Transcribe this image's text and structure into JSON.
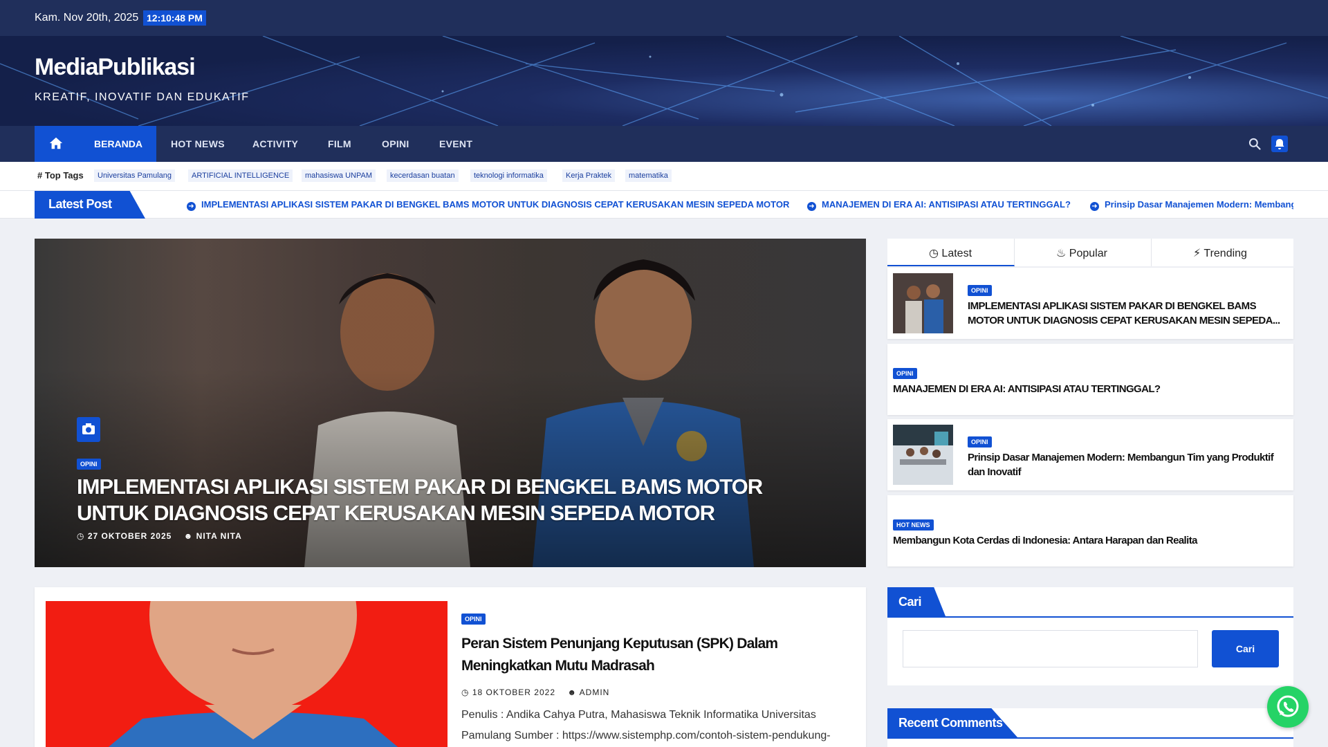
{
  "topbar": {
    "date": "Kam. Nov 20th, 2025",
    "time": "12:10:48 PM"
  },
  "site": {
    "title": "MediaPublikasi",
    "tagline": "KREATIF, INOVATIF DAN EDUKATIF"
  },
  "nav": {
    "home_label": "BERANDA",
    "items": [
      "HOT NEWS",
      "ACTIVITY",
      "FILM",
      "OPINI",
      "EVENT"
    ]
  },
  "top_tags": {
    "label": "Top Tags",
    "tags": [
      "Universitas Pamulang",
      "ARTIFICIAL INTELLIGENCE",
      "mahasiswa UNPAM",
      "kecerdasan buatan",
      "teknologi informatika",
      "Kerja Praktek",
      "matematika"
    ]
  },
  "ticker": {
    "label": "Latest Post",
    "items": [
      "IMPLEMENTASI APLIKASI SISTEM PAKAR DI BENGKEL BAMS MOTOR UNTUK DIAGNOSIS CEPAT KERUSAKAN MESIN SEPEDA MOTOR",
      "MANAJEMEN DI ERA AI: ANTISIPASI ATAU TERTINGGAL?",
      "Prinsip Dasar Manajemen Modern: Membangun Tim yang Produktif dan Inovatif"
    ]
  },
  "hero": {
    "category": "OPINI",
    "title": "IMPLEMENTASI APLIKASI SISTEM PAKAR DI BENGKEL BAMS MOTOR UNTUK DIAGNOSIS CEPAT KERUSAKAN MESIN SEPEDA MOTOR",
    "date": "27 OKTOBER 2025",
    "author": "NITA NITA"
  },
  "post": {
    "category": "OPINI",
    "title": "Peran Sistem Penunjang Keputusan (SPK) Dalam Meningkatkan Mutu Madrasah",
    "date": "18 OKTOBER 2022",
    "author": "ADMIN",
    "excerpt": "Penulis : Andika Cahya Putra, Mahasiswa Teknik Informatika Universitas Pamulang Sumber : https://www.sistemphp.com/contoh-sistem-pendukung-"
  },
  "sidebar": {
    "tabs": [
      "Latest",
      "Popular",
      "Trending"
    ],
    "posts": [
      {
        "category": "OPINI",
        "title": "IMPLEMENTASI APLIKASI SISTEM PAKAR DI BENGKEL BAMS MOTOR UNTUK DIAGNOSIS CEPAT KERUSAKAN MESIN SEPEDA..."
      },
      {
        "category": "OPINI",
        "title": "MANAJEMEN DI ERA AI: ANTISIPASI ATAU TERTINGGAL?"
      },
      {
        "category": "OPINI",
        "title": "Prinsip Dasar Manajemen Modern: Membangun Tim yang Produktif dan Inovatif"
      },
      {
        "category": "HOT NEWS",
        "title": "Membangun Kota Cerdas di Indonesia: Antara Harapan dan Realita"
      }
    ],
    "search": {
      "heading": "Cari",
      "placeholder": "",
      "button": "Cari"
    },
    "recent_comments": {
      "heading": "Recent Comments"
    }
  },
  "colors": {
    "primary": "#1151d3",
    "navy": "#202f5b",
    "whatsapp": "#25d366"
  },
  "icons": [
    "home-icon",
    "search-icon",
    "bell-icon",
    "camera-icon",
    "clock-icon",
    "user-icon",
    "fire-icon",
    "bolt-icon",
    "arrow-circle-icon",
    "whatsapp-icon"
  ]
}
